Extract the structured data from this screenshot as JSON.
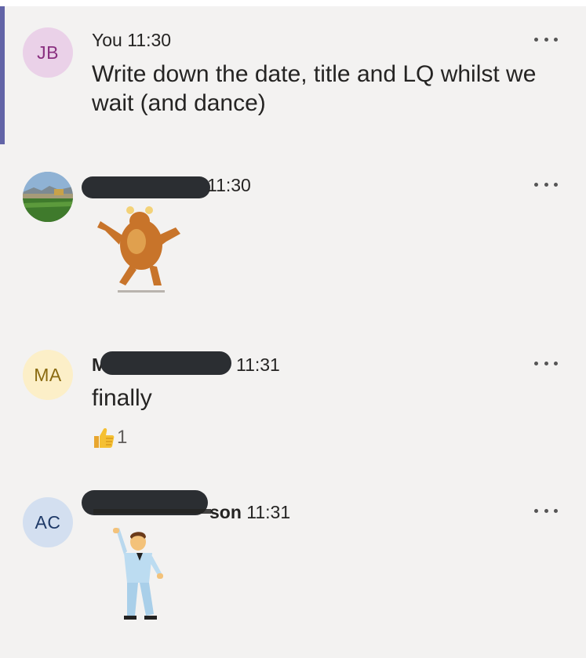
{
  "colors": {
    "background": "#f3f2f1",
    "accent": "#6264a7",
    "redaction": "#2b2e32"
  },
  "messages": [
    {
      "avatar_initials": "JB",
      "sender": "You",
      "time": "11:30",
      "text_line1": "Write down the date, title and LQ whilst we",
      "text_line2": "wait (and dance)",
      "more_icon": "more-options-icon"
    },
    {
      "avatar": "photo-avatar",
      "time": "11:30",
      "sticker": "dancing-turkey-gif",
      "more_icon": "more-options-icon"
    },
    {
      "avatar_initials": "MA",
      "sender_visible": "M",
      "time": "11:31",
      "text": "finally",
      "reaction_icon": "thumbs-up-icon",
      "reaction_count": "1",
      "more_icon": "more-options-icon"
    },
    {
      "avatar_initials": "AC",
      "sender_visible": "son",
      "time": "11:31",
      "sticker": "disco-dancer-gif",
      "more_icon": "more-options-icon"
    }
  ]
}
